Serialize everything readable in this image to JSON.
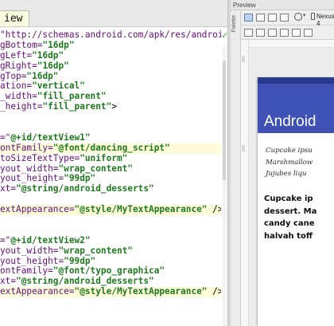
{
  "editor": {
    "tab_label": "iew",
    "lines": [
      [
        [
          "a",
          "\"http://schemas.android.com/apk/res/android\""
        ]
      ],
      [
        [
          "a",
          "gBottom="
        ],
        [
          "s",
          "\"16dp\""
        ]
      ],
      [
        [
          "a",
          "gLeft="
        ],
        [
          "s",
          "\"16dp\""
        ]
      ],
      [
        [
          "a",
          "gRight="
        ],
        [
          "s",
          "\"16dp\""
        ]
      ],
      [
        [
          "a",
          "gTop="
        ],
        [
          "s",
          "\"16dp\""
        ]
      ],
      [
        [
          "a",
          "ation="
        ],
        [
          "s",
          "\"vertical\""
        ]
      ],
      [
        [
          "a",
          "_width="
        ],
        [
          "s",
          "\"fill_parent\""
        ]
      ],
      [
        [
          "a",
          "_height="
        ],
        [
          "s",
          "\"fill_parent\""
        ],
        [
          "o",
          ">"
        ]
      ],
      [],
      [],
      [
        [
          "a",
          "=\""
        ],
        [
          "s",
          "@+id/textView1\""
        ]
      ],
      [
        [
          "a",
          "ontFamily="
        ],
        [
          "s",
          "\"@font/dancing_script\""
        ]
      ],
      [
        [
          "a",
          "toSizeTextType="
        ],
        [
          "s",
          "\"uniform\""
        ]
      ],
      [
        [
          "a",
          "yout_width="
        ],
        [
          "s",
          "\"wrap_content\""
        ]
      ],
      [
        [
          "a",
          "yout_height="
        ],
        [
          "s",
          "\"99dp\""
        ]
      ],
      [
        [
          "a",
          "xt="
        ],
        [
          "s",
          "\"@string/android_desserts\""
        ]
      ],
      [],
      [
        [
          "a",
          "extAppearance="
        ],
        [
          "s",
          "\"@style/MyTextAppearance\""
        ],
        [
          "o",
          " />"
        ]
      ],
      [],
      [],
      [
        [
          "a",
          "=\""
        ],
        [
          "s",
          "@+id/textView2\""
        ]
      ],
      [
        [
          "a",
          "yout_width="
        ],
        [
          "s",
          "\"wrap_content\""
        ]
      ],
      [
        [
          "a",
          "yout_height="
        ],
        [
          "s",
          "\"99dp\""
        ]
      ],
      [
        [
          "a",
          "ontFamily="
        ],
        [
          "s",
          "\"@font/typo_graphica\""
        ]
      ],
      [
        [
          "a",
          "xt="
        ],
        [
          "s",
          "\"@string/android_desserts\""
        ]
      ],
      [
        [
          "a",
          "extAppearance="
        ],
        [
          "s",
          "\"@style/MyTextAppearance\""
        ],
        [
          "o",
          " />"
        ]
      ]
    ],
    "highlighted_lines": [
      11,
      17,
      25
    ]
  },
  "preview": {
    "panel_title": "Preview",
    "palette_label": "Palette",
    "device_label": "Nexus 4",
    "ruler_labels": [
      "100",
      "200"
    ],
    "app_title": "Android",
    "script_lines": [
      "Cupcake ipsu",
      "Marshmallow",
      "Jujubes liqu"
    ],
    "bold_lines": [
      "Cupcake ip",
      "dessert. Ma",
      "candy cane",
      "halvah toff"
    ],
    "colors": {
      "app_bar": "#3f51b5",
      "status_bar": "#2a3a90",
      "attr": "#660e7a",
      "string": "#1f7a1f"
    }
  }
}
